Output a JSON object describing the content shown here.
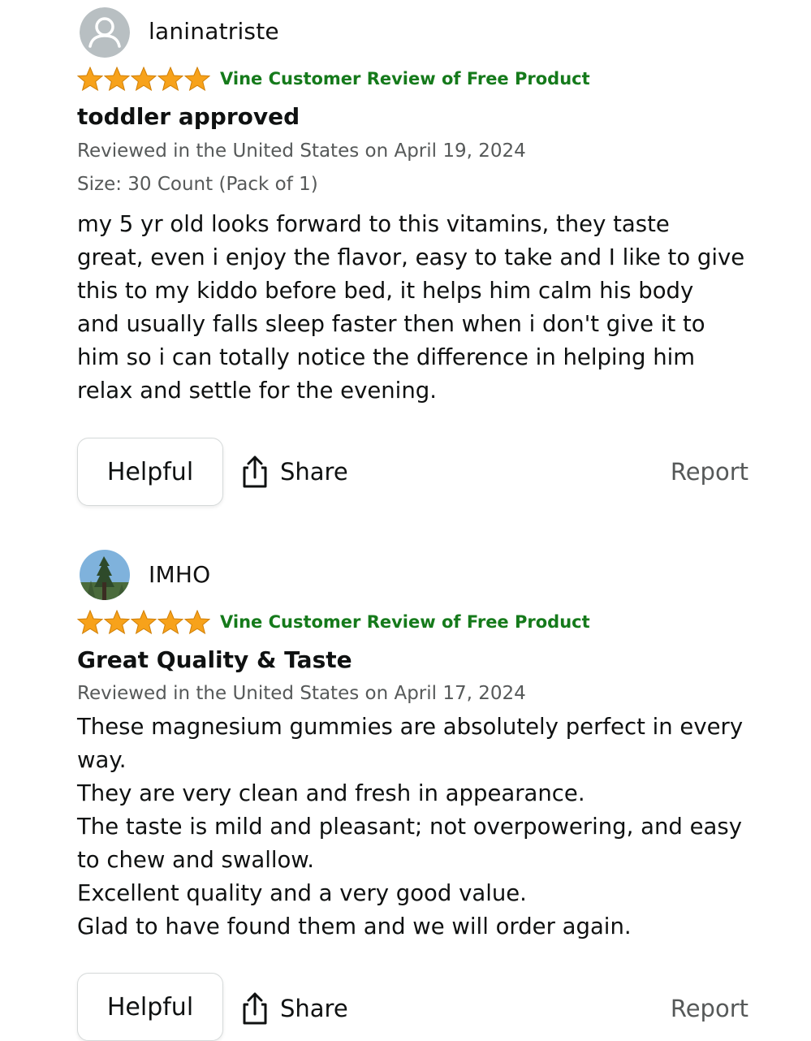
{
  "colors": {
    "star": "#f7a21b",
    "vine": "#157a1b",
    "meta": "#565959"
  },
  "reviews": [
    {
      "username": "laninatriste",
      "avatar_icon": "default-user-avatar-icon",
      "rating": 5,
      "vine_label": "Vine Customer Review of Free Product",
      "title": "toddler approved",
      "reviewed_line": "Reviewed in the United States on April 19, 2024",
      "size_line": "Size: 30 Count (Pack of 1)",
      "body_lines": [
        "my 5 yr old looks forward to this vitamins, they taste",
        "great, even i enjoy the flavor, easy to take and I like to give",
        "this to my kiddo before bed, it helps him calm his body",
        "and usually falls sleep faster then when i don't give it to",
        "him so i can totally notice the difference in helping him",
        "relax and settle for the evening."
      ],
      "helpful_label": "Helpful",
      "share_label": "Share",
      "report_label": "Report"
    },
    {
      "username": "IMHO",
      "avatar_icon": "tree-photo-avatar",
      "rating": 5,
      "vine_label": "Vine Customer Review of Free Product",
      "title": "Great Quality & Taste",
      "reviewed_line": "Reviewed in the United States on April 17, 2024",
      "body_lines": [
        "These magnesium gummies are absolutely perfect in every",
        "way.",
        "They are very clean and fresh in appearance.",
        "The taste is mild and pleasant; not overpowering, and easy",
        "to chew and swallow.",
        "Excellent quality and a very good value.",
        "Glad to have found them and we will order again."
      ],
      "helpful_label": "Helpful",
      "share_label": "Share",
      "report_label": "Report"
    }
  ]
}
